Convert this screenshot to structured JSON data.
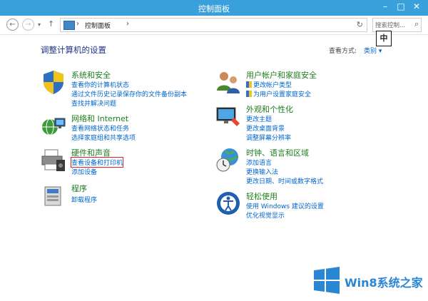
{
  "window": {
    "title": "控制面板",
    "minimize_glyph": "–",
    "maximize_glyph": "□",
    "close_glyph": "✕"
  },
  "nav": {
    "back_glyph": "←",
    "forward_glyph": "→",
    "recent_glyph": "▾",
    "up_glyph": "↑",
    "breadcrumb": "控制面板",
    "breadcrumb_sep": "›",
    "refresh_glyph": "↻",
    "search_placeholder": "搜索控制...",
    "search_glyph": "⌕"
  },
  "ime": {
    "label": "中"
  },
  "main": {
    "title": "调整计算机的设置",
    "view_by_label": "查看方式:",
    "view_by_value": "类别 ▾"
  },
  "categories": {
    "system": {
      "title": "系统和安全",
      "links": [
        "查看你的计算机状态",
        "通过文件历史记录保存你的文件备份副本",
        "查找并解决问题"
      ]
    },
    "network": {
      "title": "网络和 Internet",
      "links": [
        "查看网络状态和任务",
        "选择家庭组和共享选项"
      ]
    },
    "hardware": {
      "title": "硬件和声音",
      "links": [
        "查看设备和打印机",
        "添加设备"
      ]
    },
    "programs": {
      "title": "程序",
      "links": [
        "卸载程序"
      ]
    },
    "accounts": {
      "title": "用户帐户和家庭安全",
      "links": [
        "更改帐户类型",
        "为用户设置家庭安全"
      ]
    },
    "appearance": {
      "title": "外观和个性化",
      "links": [
        "更改主题",
        "更改桌面背景",
        "调整屏幕分辨率"
      ]
    },
    "clock": {
      "title": "时钟、语言和区域",
      "links": [
        "添加语言",
        "更换输入法",
        "更改日期、时间或数字格式"
      ]
    },
    "ease": {
      "title": "轻松使用",
      "links": [
        "使用 Windows 建议的设置",
        "优化视觉显示"
      ]
    }
  },
  "watermark": {
    "text": "Win8系统之家"
  },
  "colors": {
    "titlebar": "#3aa0dc",
    "link": "#0066cc",
    "category": "#1e7d1e",
    "heading": "#1e3287",
    "highlight": "#e02020"
  }
}
